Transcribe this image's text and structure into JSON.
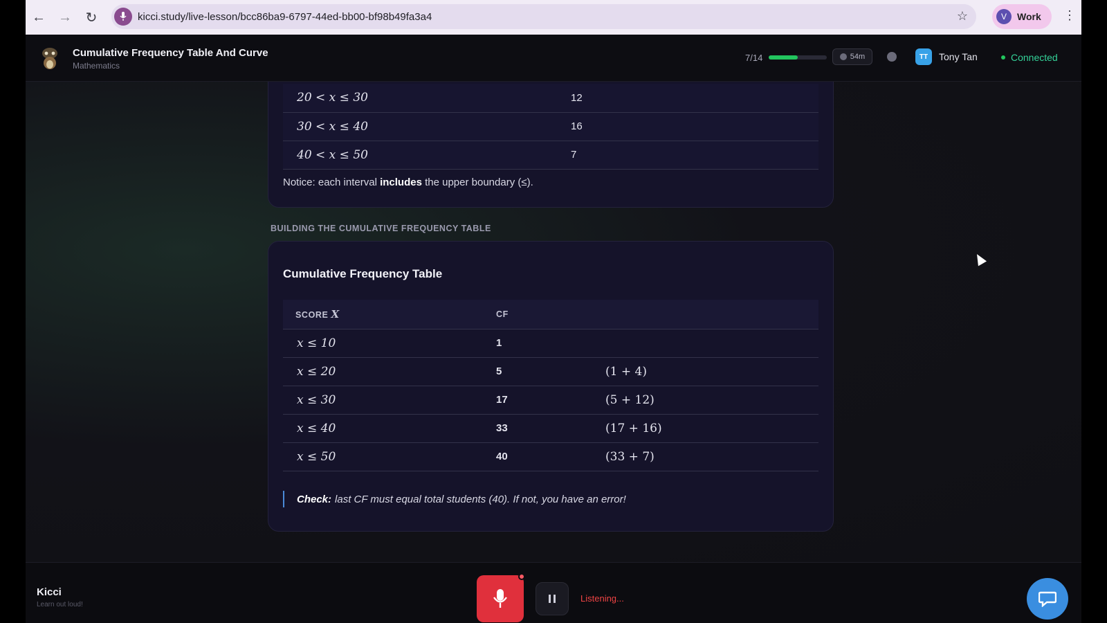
{
  "browser": {
    "url": "kicci.study/live-lesson/bcc86ba9-6797-44ed-bb00-bf98b49fa3a4",
    "profile_initial": "V",
    "profile_label": "Work"
  },
  "header": {
    "title": "Cumulative Frequency Table And Curve",
    "subject": "Mathematics",
    "progress_text": "7/14",
    "progress_fraction": 0.5,
    "timer": "54m",
    "user_initials": "TT",
    "user_name": "Tony Tan",
    "status": "Connected"
  },
  "frequency_table": {
    "rows": [
      {
        "interval": "20 < x ≤ 30",
        "frequency": "12"
      },
      {
        "interval": "30 < x ≤ 40",
        "frequency": "16"
      },
      {
        "interval": "40 < x ≤ 50",
        "frequency": "7"
      }
    ],
    "notice_pre": "Notice: each interval ",
    "notice_bold": "includes",
    "notice_post": " the upper boundary (≤)."
  },
  "section_label": "BUILDING THE CUMULATIVE FREQUENCY TABLE",
  "cf_table": {
    "title": "Cumulative Frequency Table",
    "header_score": "SCORE",
    "header_score_var": "X",
    "header_cf": "CF",
    "rows": [
      {
        "bound": "x ≤ 10",
        "cf": "1",
        "sum": ""
      },
      {
        "bound": "x ≤ 20",
        "cf": "5",
        "sum": "(1 + 4)"
      },
      {
        "bound": "x ≤ 30",
        "cf": "17",
        "sum": "(5 + 12)"
      },
      {
        "bound": "x ≤ 40",
        "cf": "33",
        "sum": "(17 + 16)"
      },
      {
        "bound": "x ≤ 50",
        "cf": "40",
        "sum": "(33 + 7)"
      }
    ],
    "check_bold": "Check:",
    "check_text": "last CF must equal total students (40). If not, you have an error!"
  },
  "footer": {
    "brand": "Kicci",
    "tagline": "Learn out loud!",
    "status": "Listening..."
  }
}
